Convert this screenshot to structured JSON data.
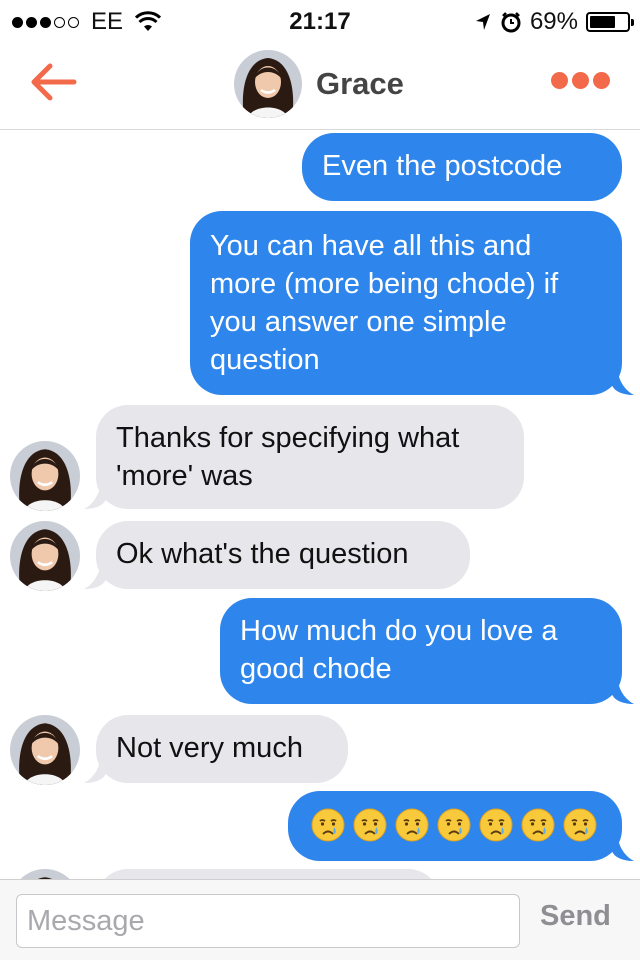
{
  "status_bar": {
    "carrier": "EE",
    "time": "21:17",
    "battery": "69%",
    "battery_level": 0.69,
    "signal_bars": 3,
    "signal_total": 5
  },
  "header": {
    "contact_name": "Grace",
    "accent_color": "#f26a4a"
  },
  "messages": [
    {
      "direction": "out",
      "text": "Even the postcode"
    },
    {
      "direction": "out",
      "text": "You can have all this and more (more being chode) if you answer one simple question"
    },
    {
      "direction": "in",
      "text": "Thanks for specifying what 'more' was"
    },
    {
      "direction": "in",
      "text": "Ok what's the question"
    },
    {
      "direction": "out",
      "text": "How much do you love a good chode"
    },
    {
      "direction": "in",
      "text": "Not very much"
    },
    {
      "direction": "out",
      "emoji": "crying-face",
      "emoji_count": 7
    }
  ],
  "input_bar": {
    "placeholder": "Message",
    "send_label": "Send"
  },
  "colors": {
    "outgoing_bubble": "#2e86ec",
    "incoming_bubble": "#e6e6eb"
  }
}
